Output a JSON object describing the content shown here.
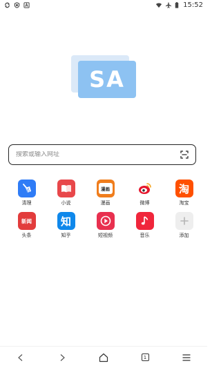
{
  "status_bar": {
    "left_icons": [
      "sync-icon",
      "shield-icon",
      "app-a-icon"
    ],
    "right_icons": [
      "wifi-icon",
      "airplane-icon",
      "battery-icon"
    ],
    "time": "15:52"
  },
  "logo": {
    "text": "SA",
    "colors": {
      "front": "#8dc2f2",
      "back": "#dbe9f8"
    }
  },
  "search": {
    "placeholder": "搜索或输入网址",
    "value": ""
  },
  "shortcuts": [
    {
      "label": "清理",
      "icon": "broom-icon",
      "color": "#2f7cf6"
    },
    {
      "label": "小说",
      "icon": "book-icon",
      "color": "#e8474a"
    },
    {
      "label": "漫画",
      "icon": "comic-icon",
      "color": "#f07d1c",
      "icon_text": "漫画"
    },
    {
      "label": "微博",
      "icon": "weibo-icon",
      "color": "#e6162d"
    },
    {
      "label": "淘宝",
      "icon": "taobao-icon",
      "color": "#ff5000",
      "icon_text": "淘"
    },
    {
      "label": "头条",
      "icon": "news-icon",
      "color": "#e23c3c",
      "icon_text": "新闻"
    },
    {
      "label": "知乎",
      "icon": "zhihu-icon",
      "color": "#0f88eb",
      "icon_text": "知"
    },
    {
      "label": "短视频",
      "icon": "video-play-icon",
      "color": "#e8304f"
    },
    {
      "label": "音乐",
      "icon": "music-note-icon",
      "color": "#f0263b"
    },
    {
      "label": "添加",
      "icon": "plus-icon",
      "color": "#eeeeee"
    }
  ],
  "bottom_nav": {
    "items": [
      "back-icon",
      "forward-icon",
      "home-icon",
      "tabs-icon",
      "menu-icon"
    ],
    "tab_count": "1"
  }
}
